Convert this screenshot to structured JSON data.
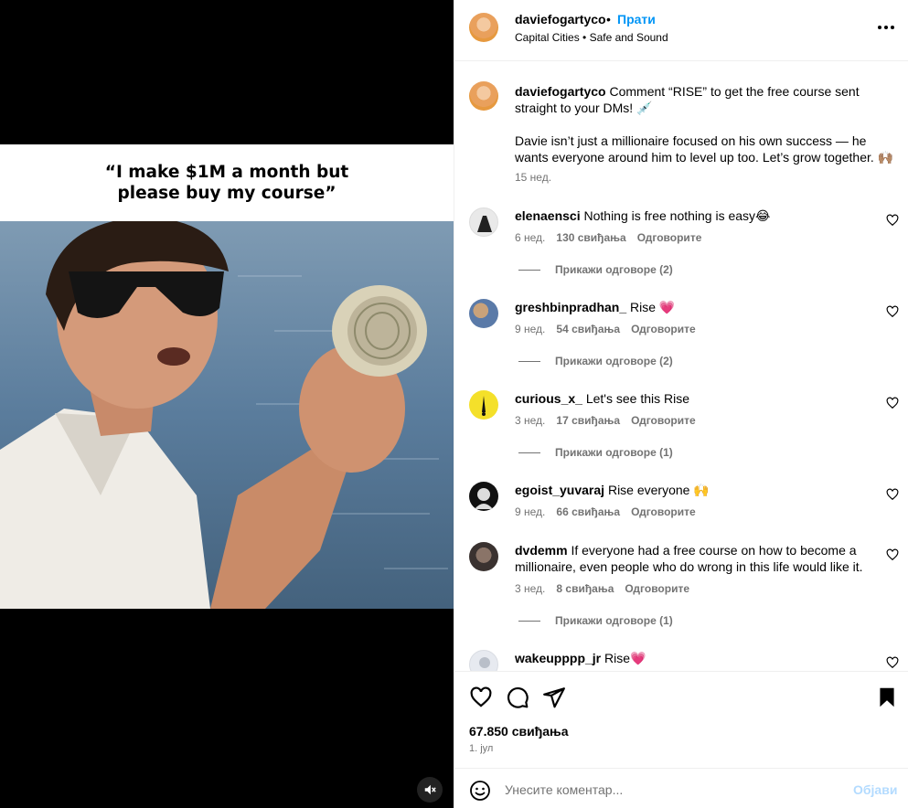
{
  "media": {
    "caption": "“I make $1M a month but\nplease buy my course”",
    "mute_icon": "speaker-muted-icon"
  },
  "header": {
    "username": "daviefogartyco",
    "dot": "•",
    "follow_label": "Прати",
    "song": "Capital Cities • Safe and Sound",
    "more_icon": "more-horizontal-icon"
  },
  "caption_post": {
    "username": "daviefogartyco",
    "text1": "Comment “RISE” to get the free course sent straight to your DMs! 💉",
    "text2": "Davie isn’t just a millionaire focused on his own success — he wants everyone around him to level up too. Let’s grow together. 🙌🏽",
    "time": "15 нед."
  },
  "comments": [
    {
      "username": "elenaensci",
      "text": "Nothing is free nothing is easy😂",
      "time": "6 нед.",
      "likes": "130 свиђања",
      "reply": "Одговорите",
      "replies": "Прикажи одговоре (2)",
      "avatar_color": "#e9e9e9"
    },
    {
      "username": "greshbinpradhan_",
      "text": "Rise 💗",
      "time": "9 нед.",
      "likes": "54 свиђања",
      "reply": "Одговорите",
      "replies": "Прикажи одговоре (2)",
      "avatar_color": "#7a8fb0"
    },
    {
      "username": "curious_x_",
      "text": "Let's see this Rise",
      "time": "3 нед.",
      "likes": "17 свиђања",
      "reply": "Одговорите",
      "replies": "Прикажи одговоре (1)",
      "avatar_color": "#f4e02a"
    },
    {
      "username": "egoist_yuvaraj",
      "text": "Rise everyone 🙌",
      "time": "9 нед.",
      "likes": "66 свиђања",
      "reply": "Одговорите",
      "replies": "",
      "avatar_color": "#111111"
    },
    {
      "username": "dvdemm",
      "text": "If everyone had a free course on how to become a millionaire, even people who do wrong in this life would like it.",
      "time": "3 нед.",
      "likes": "8 свиђања",
      "reply": "Одговорите",
      "replies": "Прикажи одговоре (1)",
      "avatar_color": "#4a3f3a"
    },
    {
      "username": "wakeupppp_jr",
      "text": "Rise💗",
      "time": "",
      "likes": "",
      "reply": "",
      "replies": "",
      "avatar_color": "#d8dde6"
    }
  ],
  "actions": {
    "like_icon": "heart-icon",
    "comment_icon": "comment-icon",
    "share_icon": "send-icon",
    "save_icon": "bookmark-icon",
    "likes": "67.850 свиђања",
    "date": "1. јул"
  },
  "composer": {
    "emoji_icon": "emoji-icon",
    "placeholder": "Унесите коментар...",
    "post_label": "Објави"
  }
}
